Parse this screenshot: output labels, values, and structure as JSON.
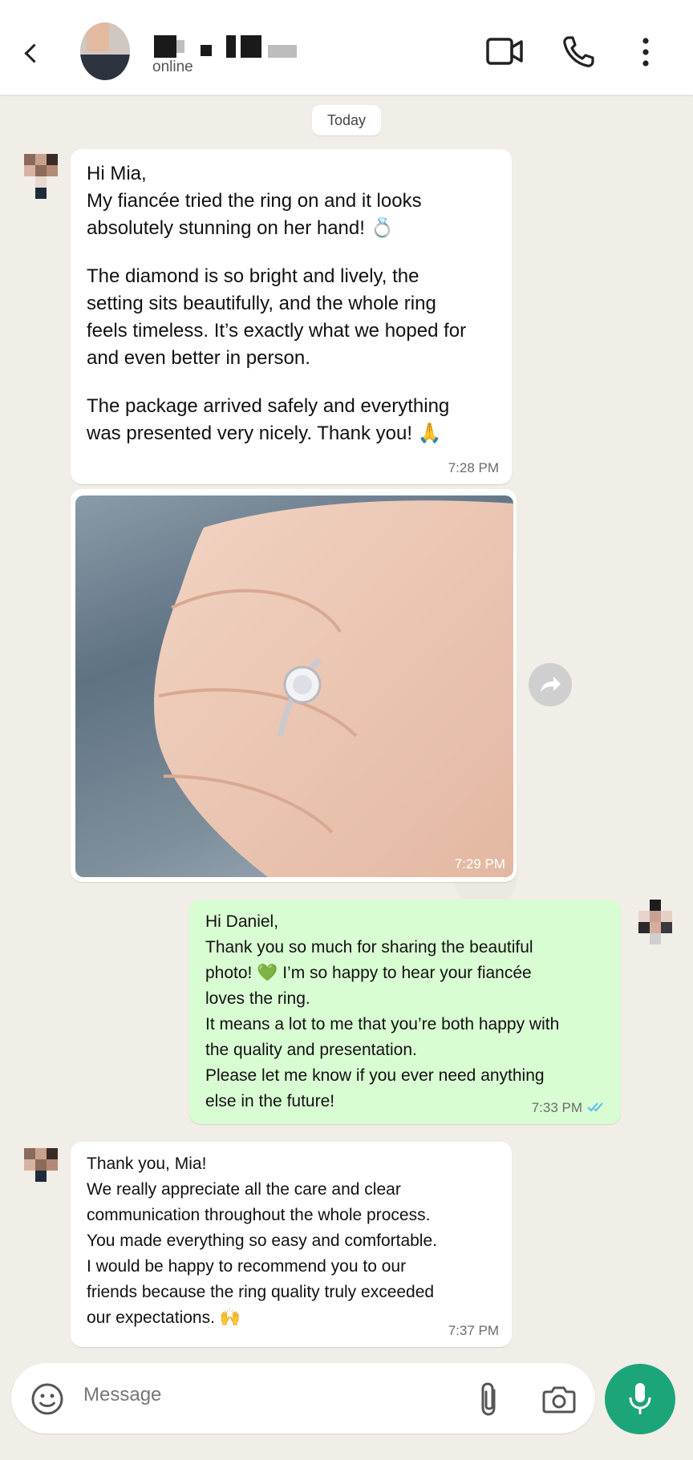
{
  "header": {
    "status": "online"
  },
  "date_chip": "Today",
  "messages": [
    {
      "lines1": [
        "Hi Mia,",
        "My fiancée tried the ring on and it looks",
        "absolutely stunning on her hand! 💍"
      ],
      "lines2": [
        "The diamond is so bright and lively, the",
        "setting sits beautifully, and the whole ring",
        "feels timeless. It’s exactly what we hoped for",
        "and even better in person."
      ],
      "lines3": [
        "The package arrived safely and everything",
        "was presented very nicely. Thank you! 🙏"
      ],
      "time": "7:28 PM"
    },
    {
      "time": "7:29 PM"
    },
    {
      "lines": [
        "Hi Daniel,",
        "Thank you so much for sharing the beautiful",
        "photo! 💚 I’m so happy to hear your fiancée",
        "loves the ring.",
        "It means a lot to me that you’re both happy with",
        "the quality and presentation.",
        "Please let me know if you ever need anything",
        "else in the future!"
      ],
      "time": "7:33 PM"
    },
    {
      "lines": [
        "Thank you, Mia!",
        "We really appreciate all the care and clear",
        "communication throughout the whole process.",
        "You made everything so easy and comfortable.",
        "I would be happy to recommend you to our",
        "friends because the ring quality truly exceeded",
        "our expectations. 🙌"
      ],
      "time": "7:37 PM"
    }
  ],
  "composer": {
    "placeholder": "Message"
  },
  "colors": {
    "accent": "#1da57a",
    "outgoing_bubble": "#d9fdd3",
    "read_ticks": "#53bdeb"
  }
}
